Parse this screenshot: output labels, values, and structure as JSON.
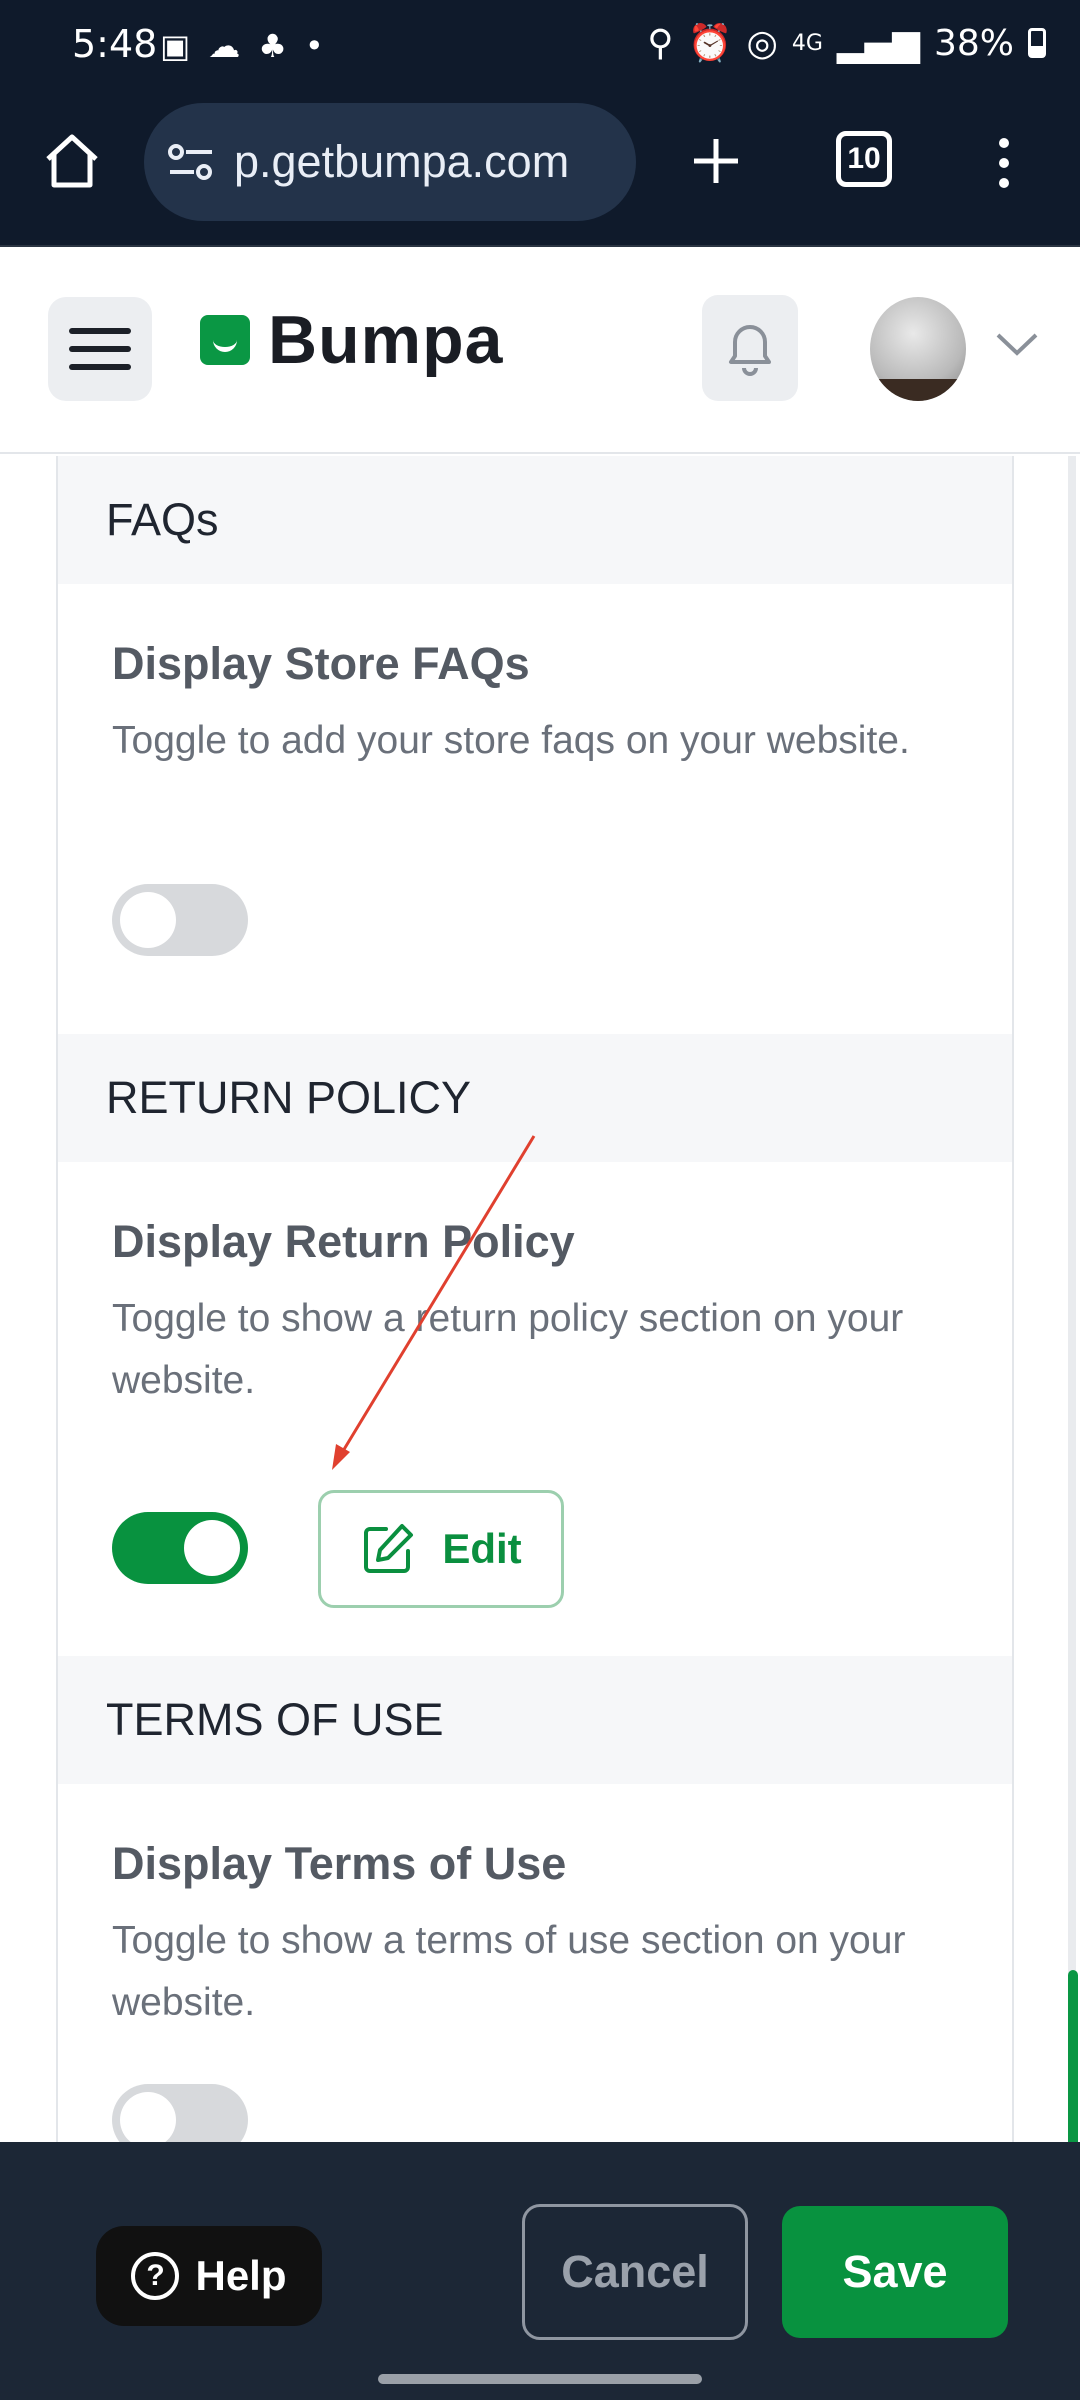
{
  "status_bar": {
    "time": "5:48",
    "left_icons": [
      "image-icon",
      "cloud-icon",
      "notification-icon",
      "dot-icon"
    ],
    "right_icons": [
      "battery-saver-icon",
      "alarm-icon",
      "hotspot-icon",
      "4g-icon",
      "signal-icon"
    ],
    "network": "4G",
    "battery": "38%"
  },
  "browser": {
    "url": "p.getbumpa.com",
    "tab_count": "10"
  },
  "app_header": {
    "brand": "Bumpa"
  },
  "sections": [
    {
      "heading": "FAQs",
      "title": "Display Store FAQs",
      "description": "Toggle to add your store faqs on your website.",
      "toggle_on": false
    },
    {
      "heading": "RETURN POLICY",
      "title": "Display Return Policy",
      "description": "Toggle to show a return policy section on your website.",
      "toggle_on": true,
      "edit_label": "Edit"
    },
    {
      "heading": "TERMS OF USE",
      "title": "Display Terms of Use",
      "description": "Toggle to show a terms of use section on your website.",
      "toggle_on": false
    }
  ],
  "footer": {
    "help_label": "Help",
    "cancel_label": "Cancel",
    "save_label": "Save"
  },
  "colors": {
    "brand_green": "#08923f",
    "annotation_arrow": "#e0402f"
  }
}
